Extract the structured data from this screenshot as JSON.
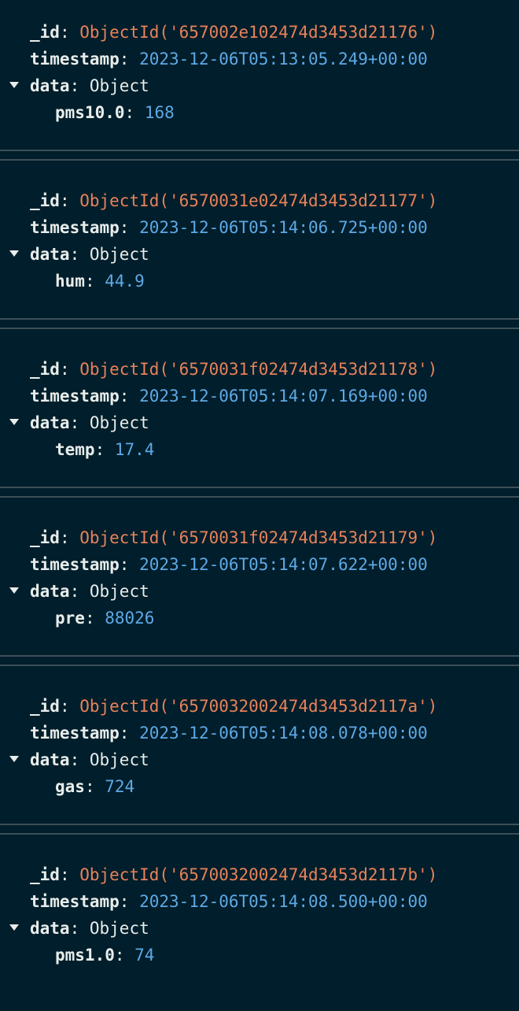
{
  "labels": {
    "id_key": "_id",
    "timestamp_key": "timestamp",
    "data_key": "data",
    "colon": ": ",
    "object_type": "Object"
  },
  "icons": {
    "expand": "caret-down-icon"
  },
  "colors": {
    "background": "#001e2b",
    "objectid": "#e8825a",
    "value": "#5ea9e6",
    "key": "#e8edeb",
    "separator": "#3d4f58"
  },
  "documents": [
    {
      "id": "ObjectId('657002e102474d3453d21176')",
      "timestamp": "2023-12-06T05:13:05.249+00:00",
      "field": "pms10.0",
      "value": "168"
    },
    {
      "id": "ObjectId('6570031e02474d3453d21177')",
      "timestamp": "2023-12-06T05:14:06.725+00:00",
      "field": "hum",
      "value": "44.9"
    },
    {
      "id": "ObjectId('6570031f02474d3453d21178')",
      "timestamp": "2023-12-06T05:14:07.169+00:00",
      "field": "temp",
      "value": "17.4"
    },
    {
      "id": "ObjectId('6570031f02474d3453d21179')",
      "timestamp": "2023-12-06T05:14:07.622+00:00",
      "field": "pre",
      "value": "88026"
    },
    {
      "id": "ObjectId('6570032002474d3453d2117a')",
      "timestamp": "2023-12-06T05:14:08.078+00:00",
      "field": "gas",
      "value": "724"
    },
    {
      "id": "ObjectId('6570032002474d3453d2117b')",
      "timestamp": "2023-12-06T05:14:08.500+00:00",
      "field": "pms1.0",
      "value": "74"
    }
  ]
}
